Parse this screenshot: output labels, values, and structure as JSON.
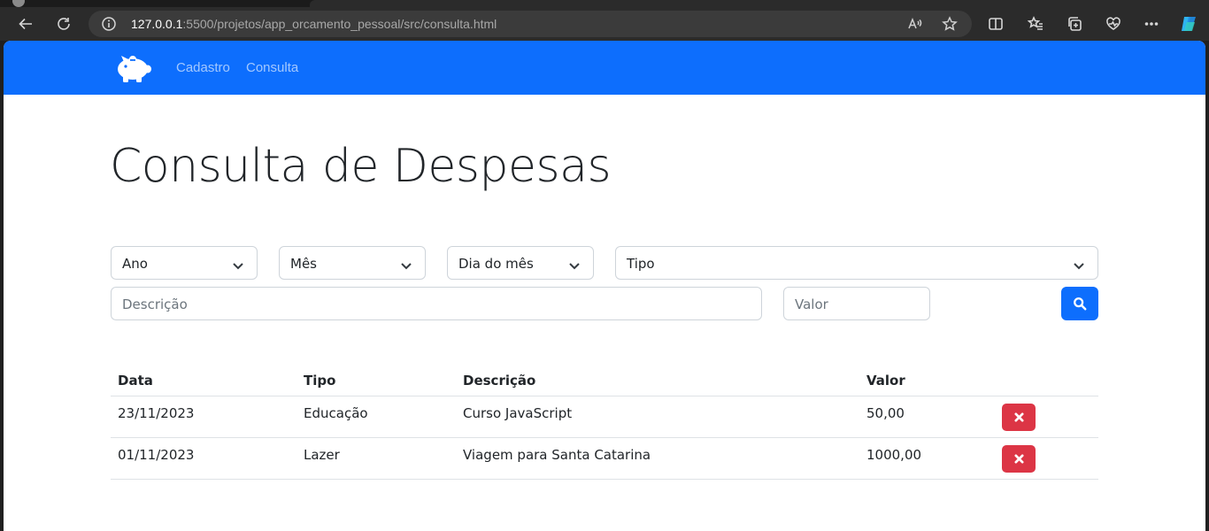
{
  "browser": {
    "url_host": "127.0.0.1",
    "url_rest": ":5500/projetos/app_orcamento_pessoal/src/consulta.html"
  },
  "navbar": {
    "brand_icon": "piggy-bank-icon",
    "links": [
      "Cadastro",
      "Consulta"
    ]
  },
  "page": {
    "title": "Consulta de Despesas"
  },
  "filters": {
    "ano": "Ano",
    "mes": "Mês",
    "dia": "Dia do mês",
    "tipo": "Tipo",
    "descricao_placeholder": "Descrição",
    "valor_placeholder": "Valor",
    "search_icon": "search-icon"
  },
  "table": {
    "headers": [
      "Data",
      "Tipo",
      "Descrição",
      "Valor"
    ],
    "rows": [
      {
        "data": "23/11/2023",
        "tipo": "Educação",
        "descricao": "Curso JavaScript",
        "valor": "50,00"
      },
      {
        "data": "01/11/2023",
        "tipo": "Lazer",
        "descricao": "Viagem para Santa Catarina",
        "valor": "1000,00"
      }
    ]
  },
  "colors": {
    "primary": "#0d6efd",
    "danger": "#dc3545"
  }
}
